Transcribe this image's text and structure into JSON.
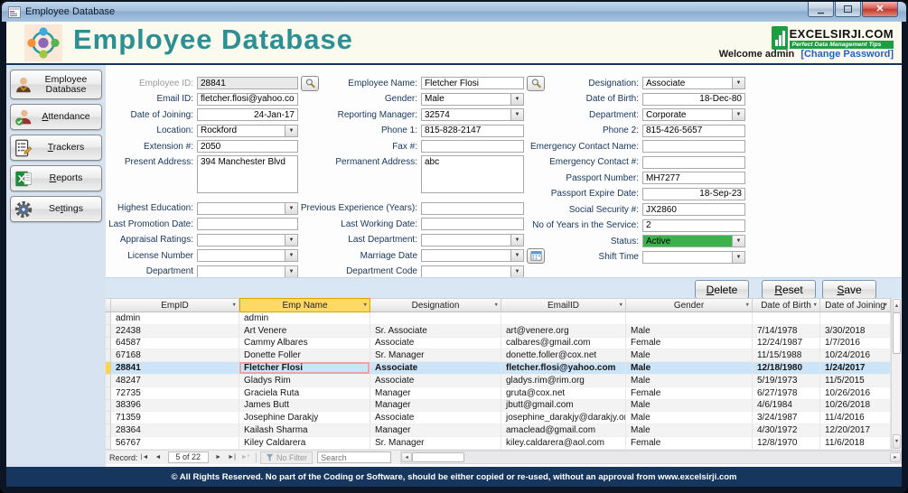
{
  "window": {
    "title": "Employee Database"
  },
  "header": {
    "app_title": "Employee Database",
    "brand": {
      "name": "EXCELSIRJI.COM",
      "tagline": "Perfect Data Management Tips"
    },
    "welcome": "Welcome admin",
    "change_password": "[Change Password]"
  },
  "sidebar": {
    "items": [
      {
        "label": "Employee Database"
      },
      {
        "label": "Attendance"
      },
      {
        "label": "Trackers"
      },
      {
        "label": "Reports"
      },
      {
        "label": "Settings"
      }
    ]
  },
  "form": {
    "columns": [
      {
        "fields": [
          {
            "label": "Employee ID:",
            "value": "28841",
            "type": "text",
            "disabled": true,
            "button": "search"
          },
          {
            "label": "Email ID:",
            "value": "fletcher.flosi@yahoo.co",
            "type": "text"
          },
          {
            "label": "Date of Joining:",
            "value": "24-Jan-17",
            "type": "text",
            "align": "right"
          },
          {
            "label": "Location:",
            "value": "Rockford",
            "type": "combo"
          },
          {
            "label": "Extension #:",
            "value": "2050",
            "type": "text"
          },
          {
            "label": "Present Address:",
            "value": "394 Manchester Blvd",
            "type": "textarea"
          },
          {
            "label": "Highest Education:",
            "value": "",
            "type": "combo",
            "group_gap": true
          },
          {
            "label": "Last Promotion Date:",
            "value": "",
            "type": "text"
          },
          {
            "label": "Appraisal Ratings:",
            "value": "",
            "type": "combo"
          },
          {
            "label": "License Number",
            "value": "",
            "type": "combo"
          },
          {
            "label": "Department",
            "value": "",
            "type": "combo"
          }
        ]
      },
      {
        "fields": [
          {
            "label": "Employee Name:",
            "value": "Fletcher Flosi",
            "type": "text",
            "button": "search"
          },
          {
            "label": "Gender:",
            "value": "Male",
            "type": "combo"
          },
          {
            "label": "Reporting Manager:",
            "value": "32574",
            "type": "combo"
          },
          {
            "label": "Phone 1:",
            "value": "815-828-2147",
            "type": "text"
          },
          {
            "label": "Fax #:",
            "value": "",
            "type": "text"
          },
          {
            "label": "Permanent Address:",
            "value": "abc",
            "type": "textarea"
          },
          {
            "label": "Previous Experience (Years):",
            "value": "",
            "type": "text",
            "group_gap": true
          },
          {
            "label": "Last Working Date:",
            "value": "",
            "type": "text"
          },
          {
            "label": "Last Department:",
            "value": "",
            "type": "combo"
          },
          {
            "label": "Marriage Date",
            "value": "",
            "type": "combo",
            "button": "calendar"
          },
          {
            "label": "Department Code",
            "value": "",
            "type": "combo"
          }
        ]
      },
      {
        "fields": [
          {
            "label": "Designation:",
            "value": "Associate",
            "type": "combo"
          },
          {
            "label": "Date of Birth:",
            "value": "18-Dec-80",
            "type": "text",
            "align": "right"
          },
          {
            "label": "Department:",
            "value": "Corporate",
            "type": "combo"
          },
          {
            "label": "Phone 2:",
            "value": "815-426-5657",
            "type": "text"
          },
          {
            "label": "Emergency Contact Name:",
            "value": "",
            "type": "text"
          },
          {
            "label": "Emergency Contact #:",
            "value": "",
            "type": "text"
          },
          {
            "label": "Passport Number:",
            "value": "MH7277",
            "type": "text"
          },
          {
            "label": "Passport Expire Date:",
            "value": "18-Sep-23",
            "type": "text",
            "align": "right"
          },
          {
            "label": "Social Security #:",
            "value": "JX2860",
            "type": "text"
          },
          {
            "label": "No of Years in the Service:",
            "value": "2",
            "type": "text"
          },
          {
            "label": "Status:",
            "value": "Active",
            "type": "combo",
            "highlight": true
          },
          {
            "label": "Shift Time",
            "value": "",
            "type": "combo"
          }
        ]
      }
    ]
  },
  "actions": {
    "delete_label": "Delete",
    "reset_label": "Reset",
    "save_label": "Save"
  },
  "table": {
    "headers": [
      "EmpID",
      "Emp Name",
      "Designation",
      "EmailID",
      "Gender",
      "Date of Birth",
      "Date of Joining"
    ],
    "active_header_index": 1,
    "selected_row_index": 4,
    "current_cell_column_index": 1,
    "rows": [
      [
        "admin",
        "admin",
        "",
        "",
        "",
        "",
        ""
      ],
      [
        "22438",
        "Art Venere",
        "Sr. Associate",
        "art@venere.org",
        "Male",
        "7/14/1978",
        "3/30/2018"
      ],
      [
        "64587",
        "Cammy Albares",
        "Associate",
        "calbares@gmail.com",
        "Female",
        "12/24/1987",
        "1/7/2016"
      ],
      [
        "67168",
        "Donette Foller",
        "Sr. Manager",
        "donette.foller@cox.net",
        "Male",
        "11/15/1988",
        "10/24/2016"
      ],
      [
        "28841",
        "Fletcher Flosi",
        "Associate",
        "fletcher.flosi@yahoo.com",
        "Male",
        "12/18/1980",
        "1/24/2017"
      ],
      [
        "48247",
        "Gladys Rim",
        "Associate",
        "gladys.rim@rim.org",
        "Male",
        "5/19/1973",
        "11/5/2015"
      ],
      [
        "72735",
        "Graciela Ruta",
        "Manager",
        "gruta@cox.net",
        "Female",
        "6/27/1978",
        "10/26/2016"
      ],
      [
        "38396",
        "James Butt",
        "Manager",
        "jbutt@gmail.com",
        "Male",
        "4/6/1984",
        "10/26/2018"
      ],
      [
        "71359",
        "Josephine Darakjy",
        "Associate",
        "josephine_darakjy@darakjy.org",
        "Male",
        "3/24/1987",
        "11/4/2016"
      ],
      [
        "28364",
        "Kailash Sharma",
        "Manager",
        "amaclead@gmail.com",
        "Male",
        "4/30/1972",
        "12/20/2017"
      ],
      [
        "56767",
        "Kiley Caldarera",
        "Sr. Manager",
        "kiley.caldarera@aol.com",
        "Female",
        "12/8/1970",
        "11/6/2018"
      ]
    ]
  },
  "record_bar": {
    "label": "Record:",
    "buttons": [
      "|◄",
      "◄",
      "►",
      "►|",
      "►*"
    ],
    "position": "5 of 22",
    "filter_label": "No Filter",
    "search_placeholder": "Search"
  },
  "footer": {
    "text": "© All Rights Reserved. No part of the Coding or Software, should be either copied or re-used, without an approval from www.excelsirji.com"
  },
  "colors": {
    "accent_teal": "#2c8f93",
    "status_green": "#3cb24d",
    "header_highlight": "#ffd965",
    "selected_row": "#cce4f8",
    "footer_navy": "#17365d"
  }
}
